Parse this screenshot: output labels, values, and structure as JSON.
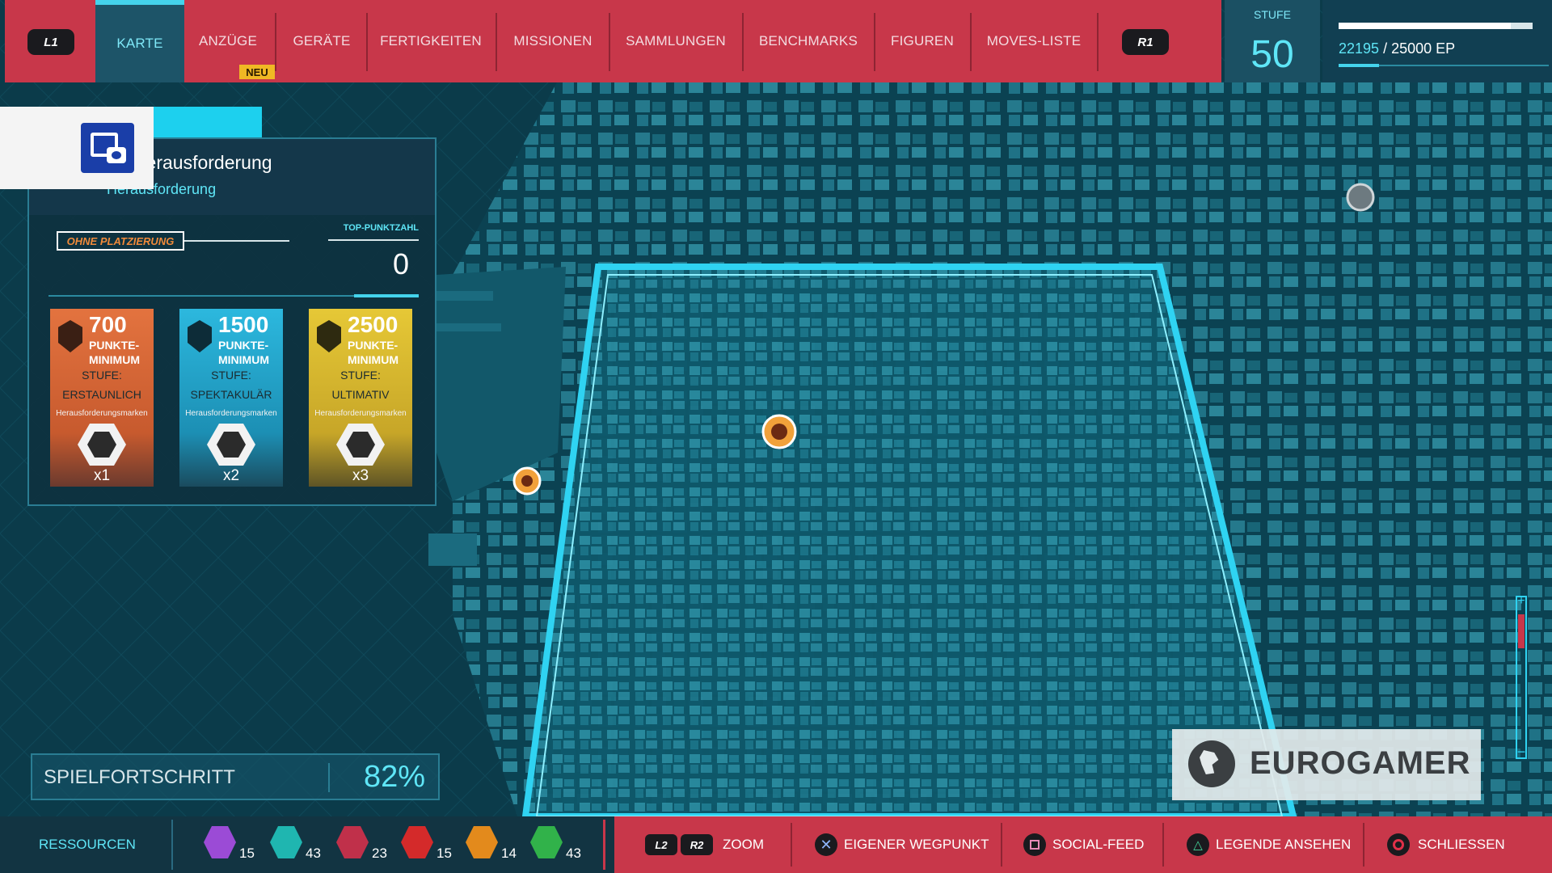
{
  "top_nav": {
    "left_shoulder": "L1",
    "right_shoulder": "R1",
    "tabs": [
      "KARTE",
      "ANZÜGE",
      "GERÄTE",
      "FERTIGKEITEN",
      "MISSIONEN",
      "SAMMLUNGEN",
      "BENCHMARKS",
      "FIGUREN",
      "MOVES-LISTE"
    ],
    "active_tab": "KARTE",
    "new_badge": "NEU"
  },
  "level": {
    "label": "STUFE",
    "value": "50"
  },
  "xp": {
    "current": "22195",
    "separator": "/",
    "total": "25000 EP",
    "progress": 0.8878
  },
  "challenge": {
    "title": "os-Herausforderung",
    "subtitle": "Herausforderung",
    "placement": "OHNE PLATZIERUNG",
    "top_score_label": "TOP-PUNKTZAHL",
    "top_score": "0",
    "tiers": [
      {
        "points": "700",
        "min_label_1": "PUNKTE-",
        "min_label_2": "MINIMUM",
        "stage_label": "STUFE:",
        "stage": "ERSTAUNLICH",
        "reward": "Herausforderungsmarken",
        "count": "x1",
        "color": "#e1693a"
      },
      {
        "points": "1500",
        "min_label_1": "PUNKTE-",
        "min_label_2": "MINIMUM",
        "stage_label": "STUFE:",
        "stage": "SPEKTAKULÄR",
        "reward": "Herausforderungsmarken",
        "count": "x2",
        "color": "#2ab0d6"
      },
      {
        "points": "2500",
        "min_label_1": "PUNKTE-",
        "min_label_2": "MINIMUM",
        "stage_label": "STUFE:",
        "stage": "ULTIMATIV",
        "reward": "Herausforderungsmarken",
        "count": "x3",
        "color": "#e4c330"
      }
    ]
  },
  "progress": {
    "label": "SPIELFORTSCHRITT",
    "value": "82%"
  },
  "watermark": {
    "text": "EUROGAMER"
  },
  "screenshot_icon": "camera-frame-icon",
  "resources": {
    "label": "RESSOURCEN",
    "items": [
      {
        "icon": "research-token-icon",
        "value": "15",
        "color": "#9b4bd6"
      },
      {
        "icon": "backpack-token-icon",
        "value": "43",
        "color": "#1fb6b0"
      },
      {
        "icon": "base-token-icon",
        "value": "23",
        "color": "#c0304a"
      },
      {
        "icon": "crime-token-icon",
        "value": "15",
        "color": "#d42a2a"
      },
      {
        "icon": "challenge-token-icon",
        "value": "14",
        "color": "#e38a1c"
      },
      {
        "icon": "landmark-token-icon",
        "value": "43",
        "color": "#31b24a"
      }
    ]
  },
  "controls": [
    {
      "keys": [
        "L2",
        "R2"
      ],
      "label": "ZOOM"
    },
    {
      "icon": "cross-button-icon",
      "label": "EIGENER WEGPUNKT"
    },
    {
      "icon": "square-button-icon",
      "label": "SOCIAL-FEED"
    },
    {
      "icon": "triangle-button-icon",
      "label": "LEGENDE ANSEHEN"
    },
    {
      "icon": "circle-button-icon",
      "label": "SCHLIESSEN"
    }
  ],
  "colors": {
    "nav_red": "#c8374a",
    "accent_cyan": "#44d3ec",
    "map_teal": "#0f5566"
  }
}
